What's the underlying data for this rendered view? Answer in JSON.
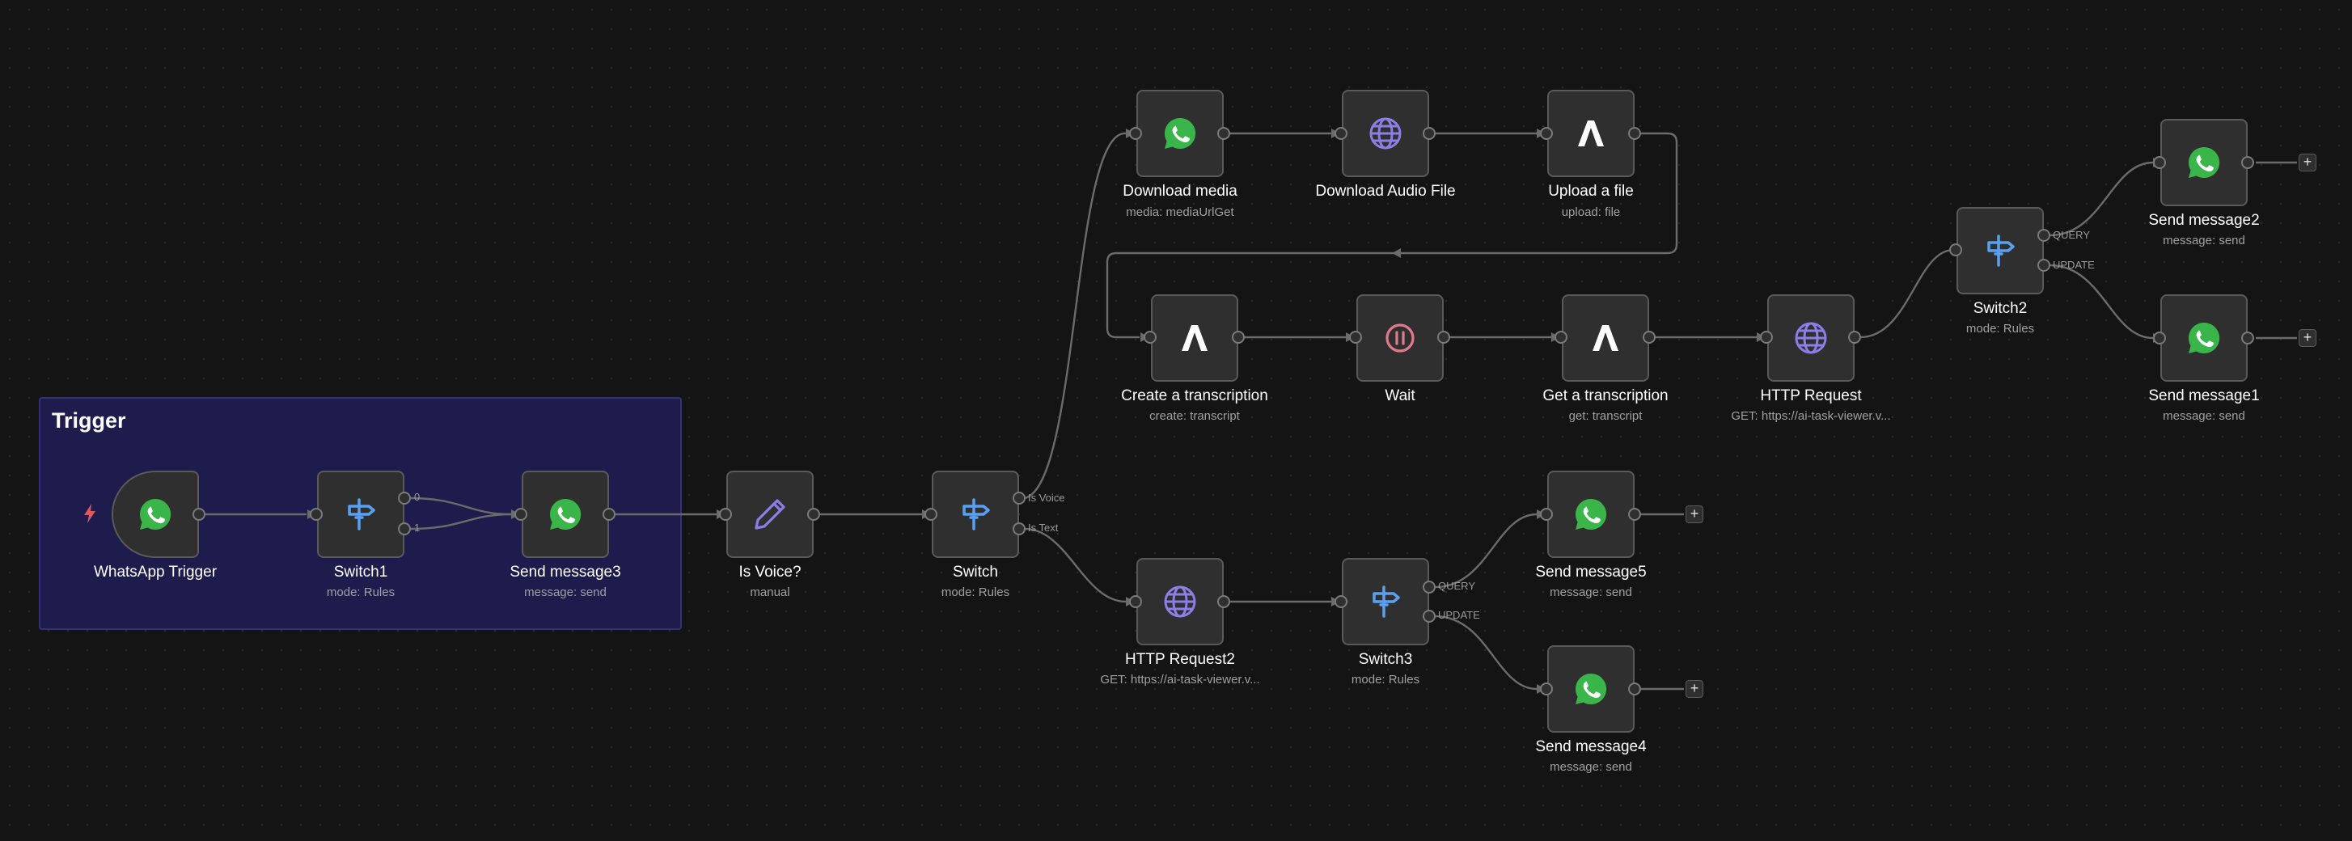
{
  "sticky": {
    "title": "Trigger"
  },
  "nodes": {
    "whatsapp_trigger": {
      "name": "WhatsApp Trigger",
      "icon": "whatsapp-icon"
    },
    "switch1": {
      "name": "Switch1",
      "sub": "mode: Rules",
      "icon": "signpost-icon",
      "outputs": [
        "0",
        "1"
      ]
    },
    "send_message3": {
      "name": "Send message3",
      "sub": "message: send",
      "icon": "whatsapp-icon"
    },
    "is_voice": {
      "name": "Is Voice?",
      "sub": "manual",
      "icon": "pencil-icon"
    },
    "switch": {
      "name": "Switch",
      "sub": "mode: Rules",
      "icon": "signpost-icon",
      "outputs": [
        "Is Voice",
        "Is Text"
      ]
    },
    "download_media": {
      "name": "Download media",
      "sub": "media: mediaUrlGet",
      "icon": "whatsapp-icon"
    },
    "download_audio": {
      "name": "Download Audio File",
      "icon": "globe-icon"
    },
    "upload_file": {
      "name": "Upload a file",
      "sub": "upload: file",
      "icon": "assemblyai-icon"
    },
    "create_transcription": {
      "name": "Create a transcription",
      "sub": "create: transcript",
      "icon": "assemblyai-icon"
    },
    "wait": {
      "name": "Wait",
      "icon": "pause-icon"
    },
    "get_transcription": {
      "name": "Get a transcription",
      "sub": "get: transcript",
      "icon": "assemblyai-icon"
    },
    "http_request": {
      "name": "HTTP Request",
      "sub": "GET: https://ai-task-viewer.v...",
      "icon": "globe-icon"
    },
    "switch2": {
      "name": "Switch2",
      "sub": "mode: Rules",
      "icon": "signpost-icon",
      "outputs": [
        "QUERY",
        "UPDATE"
      ]
    },
    "send_message2": {
      "name": "Send message2",
      "sub": "message: send",
      "icon": "whatsapp-icon"
    },
    "send_message1": {
      "name": "Send message1",
      "sub": "message: send",
      "icon": "whatsapp-icon"
    },
    "http_request2": {
      "name": "HTTP Request2",
      "sub": "GET: https://ai-task-viewer.v...",
      "icon": "globe-icon"
    },
    "switch3": {
      "name": "Switch3",
      "sub": "mode: Rules",
      "icon": "signpost-icon",
      "outputs": [
        "QUERY",
        "UPDATE"
      ]
    },
    "send_message5": {
      "name": "Send message5",
      "sub": "message: send",
      "icon": "whatsapp-icon"
    },
    "send_message4": {
      "name": "Send message4",
      "sub": "message: send",
      "icon": "whatsapp-icon"
    }
  },
  "add_button_symbol": "+",
  "colors": {
    "canvas": "#141414",
    "node_fill": "#2f2f2f",
    "sticky_fill": "#1e1b4d",
    "whatsapp": "#3ab54a",
    "globe": "#8b7fe6",
    "switch": "#5aa0f2",
    "pause": "#e07a8f",
    "trigger_bolt": "#e0575b"
  }
}
